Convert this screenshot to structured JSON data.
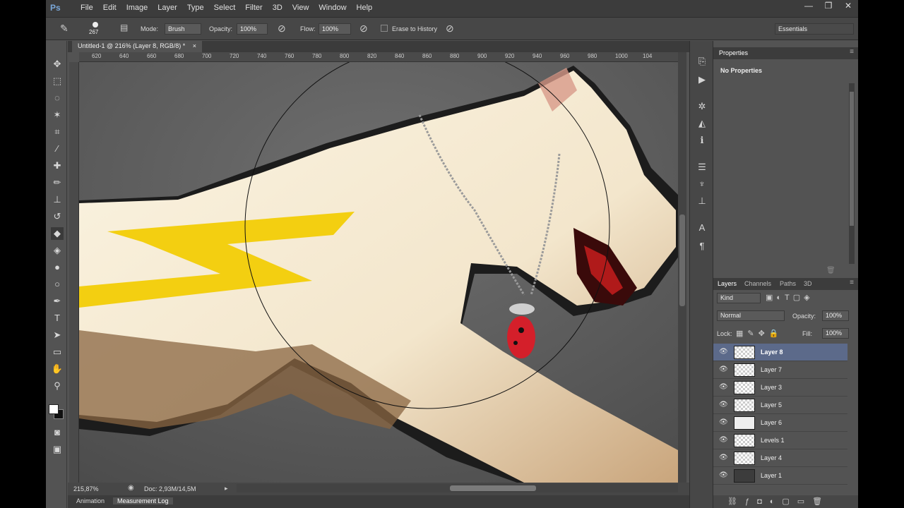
{
  "app": {
    "logo": "Ps"
  },
  "menu": [
    "File",
    "Edit",
    "Image",
    "Layer",
    "Type",
    "Select",
    "Filter",
    "3D",
    "View",
    "Window",
    "Help"
  ],
  "window_controls": {
    "minimize": "—",
    "restore": "❐",
    "close": "✕"
  },
  "options": {
    "brush_size": "267",
    "mode_label": "Mode:",
    "mode_value": "Brush",
    "opacity_label": "Opacity:",
    "opacity_value": "100%",
    "flow_label": "Flow:",
    "flow_value": "100%",
    "erase_history": "Erase to History",
    "workspace": "Essentials"
  },
  "document": {
    "tab_title": "Untitled-1 @ 216% (Layer 8, RGB/8) *",
    "ruler_ticks": [
      "620",
      "640",
      "660",
      "680",
      "700",
      "720",
      "740",
      "760",
      "780",
      "800",
      "820",
      "840",
      "860",
      "880",
      "900",
      "920",
      "940",
      "960",
      "980",
      "1000",
      "104"
    ]
  },
  "status": {
    "zoom": "215,87%",
    "doc": "Doc: 2,93M/14,5M"
  },
  "bottom_tabs": [
    "Animation",
    "Measurement Log"
  ],
  "properties": {
    "tab": "Properties",
    "empty": "No Properties"
  },
  "layers_panel": {
    "tabs": [
      "Layers",
      "Channels",
      "Paths",
      "3D"
    ],
    "kind": "Kind",
    "blend": "Normal",
    "opacity_label": "Opacity:",
    "opacity_value": "100%",
    "lock_label": "Lock:",
    "fill_label": "Fill:",
    "fill_value": "100%",
    "layers": [
      {
        "name": "Layer 8",
        "selected": true
      },
      {
        "name": "Layer 7",
        "selected": false
      },
      {
        "name": "Layer 3",
        "selected": false
      },
      {
        "name": "Layer 5",
        "selected": false
      },
      {
        "name": "Layer 6",
        "selected": false
      },
      {
        "name": "Levels 1",
        "selected": false
      },
      {
        "name": "Layer 4",
        "selected": false
      },
      {
        "name": "Layer 1",
        "selected": false
      }
    ]
  },
  "colors": {
    "selected_layer": "#5c6a8a",
    "panel": "#535353",
    "accent_yellow": "#f2cc00"
  }
}
